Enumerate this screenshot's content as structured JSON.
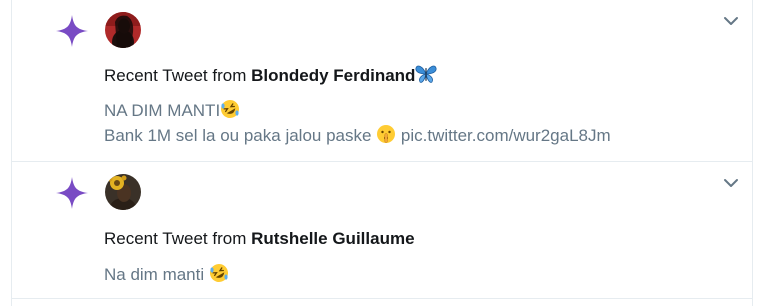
{
  "colors": {
    "sparkle": "#794bc4",
    "text_primary": "#14171a",
    "text_secondary": "#657786",
    "border": "#e6ecf0"
  },
  "notifications": [
    {
      "icon": "sparkle-icon",
      "headline_prefix": "Recent Tweet from ",
      "author": "Blondedy Ferdinand",
      "author_emoji": "butterfly-emoji",
      "line1_text": "NA DIM MANTI",
      "line1_emoji": "rolling-on-floor-laughing-emoji",
      "line2_text": "Bank 1M sel la ou paka jalou paske ",
      "line2_emoji": "shushing-face-emoji",
      "line2_link": "pic.twitter.com/wur2gaL8Jm"
    },
    {
      "icon": "sparkle-icon",
      "headline_prefix": "Recent Tweet from ",
      "author": "Rutshelle Guillaume",
      "line1_text": "Na dim manti ",
      "line1_emoji": "rolling-on-floor-laughing-emoji"
    }
  ]
}
